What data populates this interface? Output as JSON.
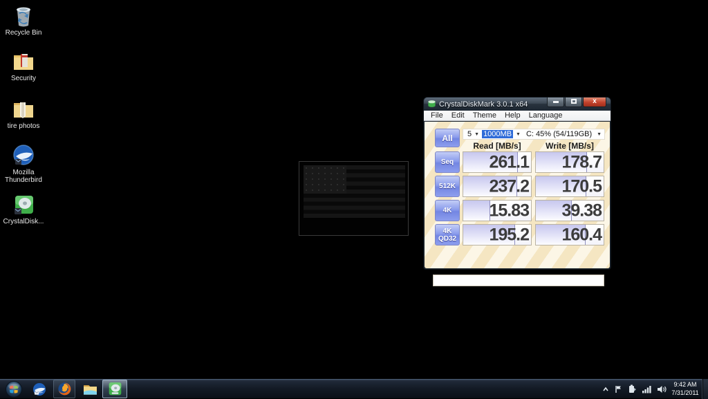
{
  "desktop": {
    "icons": [
      {
        "label": "Recycle Bin",
        "icon": "recycle-bin-icon"
      },
      {
        "label": "Security",
        "icon": "security-folder-icon"
      },
      {
        "label": "tire photos",
        "icon": "folder-icon"
      },
      {
        "label": "Mozilla Thunderbird",
        "icon": "thunderbird-icon"
      },
      {
        "label": "CrystalDisk...",
        "icon": "crystaldiskmark-icon"
      }
    ]
  },
  "window": {
    "title": "CrystalDiskMark 3.0.1 x64",
    "caption_buttons": {
      "minimize": "minimize",
      "maximize": "maximize",
      "close": "close"
    },
    "menu": {
      "file": "File",
      "edit": "Edit",
      "theme": "Theme",
      "help": "Help",
      "language": "Language"
    },
    "controls": {
      "all_button": "All",
      "test_count": "5",
      "test_size": "1000MB",
      "drive": "C: 45% (54/119GB)"
    },
    "columns": {
      "read": "Read [MB/s]",
      "write": "Write [MB/s]"
    },
    "rows": [
      {
        "label": "Seq",
        "read": "261.1",
        "write": "178.7"
      },
      {
        "label": "512K",
        "read": "237.2",
        "write": "170.5"
      },
      {
        "label": "4K",
        "read": "15.83",
        "write": "39.38"
      },
      {
        "label": "4K QD32",
        "read": "195.2",
        "write": "160.4"
      }
    ],
    "comment": ""
  },
  "taskbar": {
    "clock": {
      "time": "9:42 AM",
      "date": "7/31/2011"
    }
  },
  "colors": {
    "desktop_background": "#000000",
    "button_blue": "#8b9cec",
    "selection_blue": "#2e6bd8",
    "client_cream": "#fcf6e6",
    "client_stripe": "#f5e6c2",
    "close_red": "#c2412b",
    "titlebar_dark": "#3c4753"
  }
}
